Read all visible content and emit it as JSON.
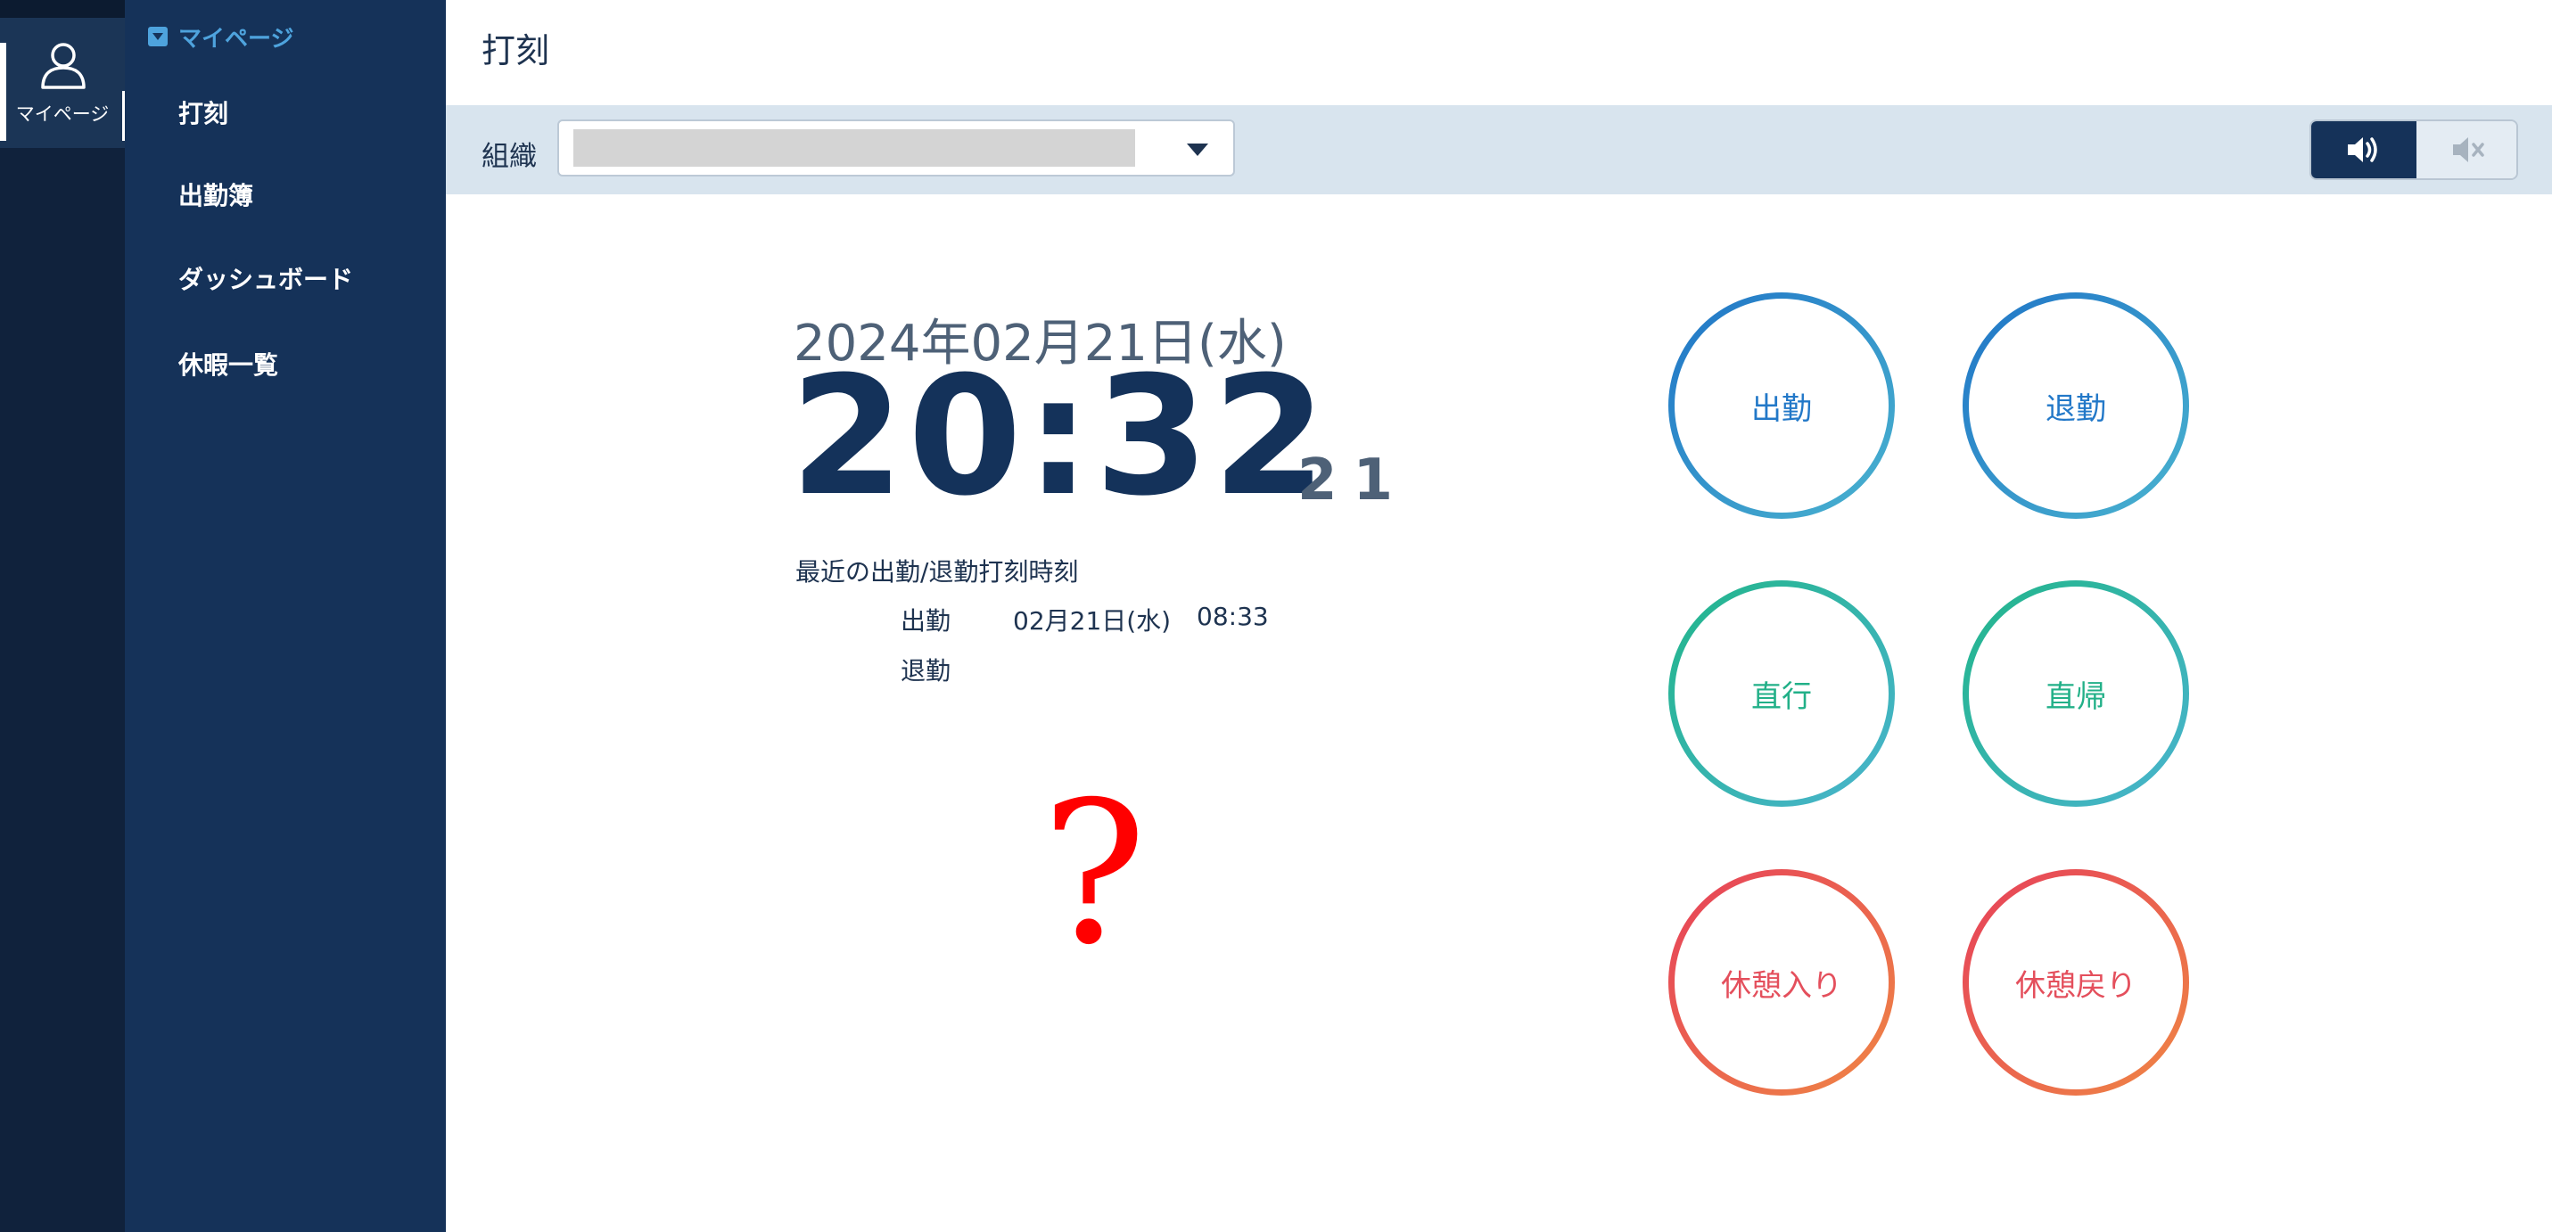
{
  "rail": {
    "mypage_label": "マイページ"
  },
  "sidebar": {
    "section_title": "マイページ",
    "items": [
      {
        "label": "打刻"
      },
      {
        "label": "出勤簿"
      },
      {
        "label": "ダッシュボード"
      },
      {
        "label": "休暇一覧"
      }
    ]
  },
  "header": {
    "title": "打刻"
  },
  "toolbar": {
    "org_label": "組織",
    "org_value": "",
    "sound_on_icon": "speaker-on-icon",
    "sound_off_icon": "speaker-mute-icon"
  },
  "clock": {
    "date": "2024年02月21日(水)",
    "time": "20:32",
    "seconds": "21"
  },
  "recent": {
    "title": "最近の出勤/退勤打刻時刻",
    "clock_in_label": "出勤",
    "clock_in_date": "02月21日(水)",
    "clock_in_time": "08:33",
    "clock_out_label": "退勤"
  },
  "overlay": {
    "mark": "?"
  },
  "buttons": {
    "clock_in": "出勤",
    "clock_out": "退勤",
    "direct_go": "直行",
    "direct_return": "直帰",
    "break_start": "休憩入り",
    "break_end": "休憩戻り"
  },
  "colors": {
    "sidebar": "#153259",
    "rail": "#10223c",
    "accent_blue": "#2278c8",
    "accent_green": "#22b088",
    "accent_red": "#e44f5c"
  }
}
